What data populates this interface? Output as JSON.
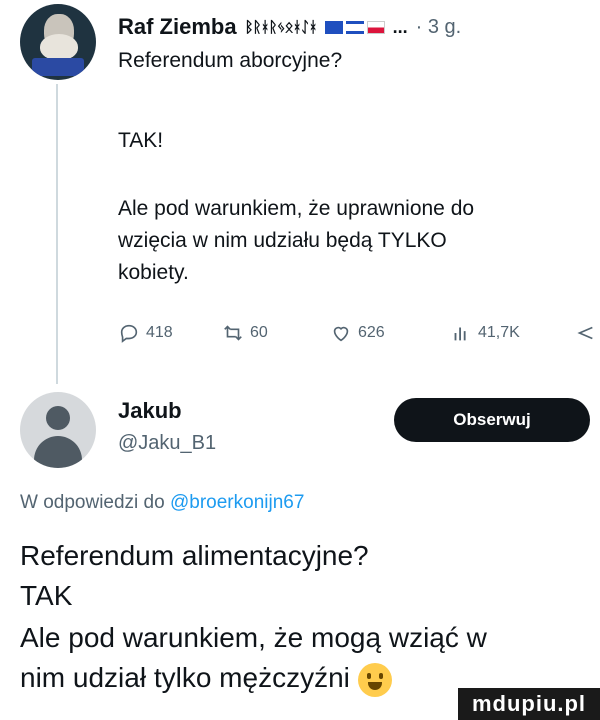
{
  "tweet": {
    "author_name": "Raf Ziemba",
    "author_badges": "ᛒᚱᚼᚱᛃᛟᚼᛇᚼ",
    "flags_more": "...",
    "time": "· 3 g.",
    "line1": "Referendum aborcyjne?",
    "line2": "TAK!",
    "line3": "Ale pod warunkiem, że uprawnione do",
    "line4": "wzięcia w nim udziału będą TYLKO",
    "line5": "kobiety.",
    "metrics": {
      "replies": "418",
      "retweets": "60",
      "likes": "626",
      "views": "41,7K"
    },
    "icons": [
      "reply-icon",
      "retweet-icon",
      "heart-icon",
      "views-icon",
      "share-icon"
    ]
  },
  "reply": {
    "author_name": "Jakub",
    "handle": "@Jaku_B1",
    "follow_label": "Obserwuj",
    "reply_to_prefix": "W odpowiedzi do",
    "reply_to_handle": "@broerkonijn67",
    "line1": "Referendum alimentacyjne?",
    "line2": "TAK",
    "line3": "Ale pod warunkiem, że mogą wziąć w",
    "line4": "nim udział tylko mężczyźni"
  },
  "watermark": "mdupiu.pl",
  "colors": {
    "text": "#0f1419",
    "secondary": "#536471",
    "link": "#1d9bf0",
    "button": "#0f1419"
  }
}
